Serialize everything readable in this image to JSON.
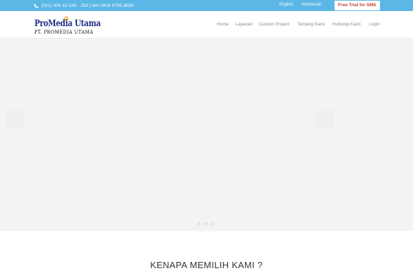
{
  "colors": {
    "topbar": "#5bb7e6",
    "trial_text": "#c23d32",
    "logo_blue": "#1e2e86",
    "logo_orange": "#f29b12",
    "nav_text": "#8a8a8a",
    "hero_bg": "#f3f3f3"
  },
  "topbar": {
    "phone_icon": "phone-icon",
    "contact": "(021) 300 10 249 - 250 | WA 0818 0785 8505",
    "languages": [
      "English",
      "Indonesian"
    ],
    "trial_button": "Free Trial for SMS"
  },
  "header": {
    "logo_title": "ProMedia Utama",
    "logo_subtitle": "PT. PROMEDIA UTAMA",
    "nav": [
      "Home",
      "Layanan",
      "Custom Project",
      "Tentang Kami",
      "Hubungi Kami",
      "Login"
    ]
  },
  "hero": {
    "slide_count": 3
  },
  "section": {
    "title": "KENAPA MEMILIH KAMI ?"
  }
}
